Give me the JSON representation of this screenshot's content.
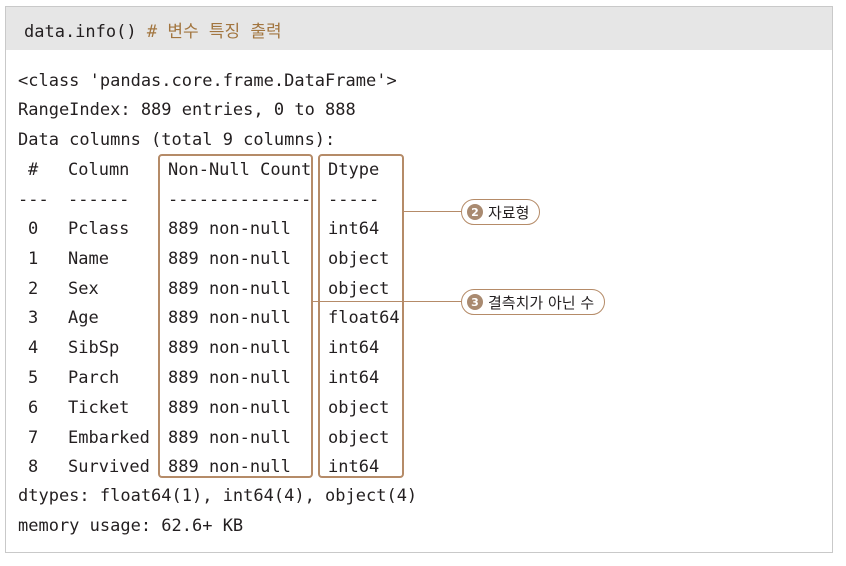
{
  "code": {
    "statement": "data.info()",
    "comment": "# 변수 특징 출력"
  },
  "output": {
    "class_line": "<class 'pandas.core.frame.DataFrame'>",
    "range_index": "RangeIndex: 889 entries, 0 to 888",
    "data_columns": "Data columns (total 9 columns):",
    "headers": {
      "idx": "#",
      "column": "Column",
      "count": "Non-Null Count",
      "dtype": "Dtype"
    },
    "separators": {
      "idx": "---",
      "column": "------",
      "count": "--------------",
      "dtype": "-----"
    },
    "rows": [
      {
        "idx": "0",
        "column": "Pclass",
        "count": "889 non-null",
        "dtype": "int64"
      },
      {
        "idx": "1",
        "column": "Name",
        "count": "889 non-null",
        "dtype": "object"
      },
      {
        "idx": "2",
        "column": "Sex",
        "count": "889 non-null",
        "dtype": "object"
      },
      {
        "idx": "3",
        "column": "Age",
        "count": "889 non-null",
        "dtype": "float64"
      },
      {
        "idx": "4",
        "column": "SibSp",
        "count": "889 non-null",
        "dtype": "int64"
      },
      {
        "idx": "5",
        "column": "Parch",
        "count": "889 non-null",
        "dtype": "int64"
      },
      {
        "idx": "6",
        "column": "Ticket",
        "count": "889 non-null",
        "dtype": "object"
      },
      {
        "idx": "7",
        "column": "Embarked",
        "count": "889 non-null",
        "dtype": "object"
      },
      {
        "idx": "8",
        "column": "Survived",
        "count": "889 non-null",
        "dtype": "int64"
      }
    ],
    "dtypes_line": "dtypes: float64(1), int64(4), object(4)",
    "memory_line": "memory usage: 62.6+ KB"
  },
  "callouts": [
    {
      "number": "2",
      "label": "자료형"
    },
    {
      "number": "3",
      "label": "결측치가 아닌 수"
    }
  ],
  "colors": {
    "accent": "#b58b68",
    "badge": "#a98a70",
    "comment": "#a2753f",
    "header_bg": "#e6e6e6"
  }
}
